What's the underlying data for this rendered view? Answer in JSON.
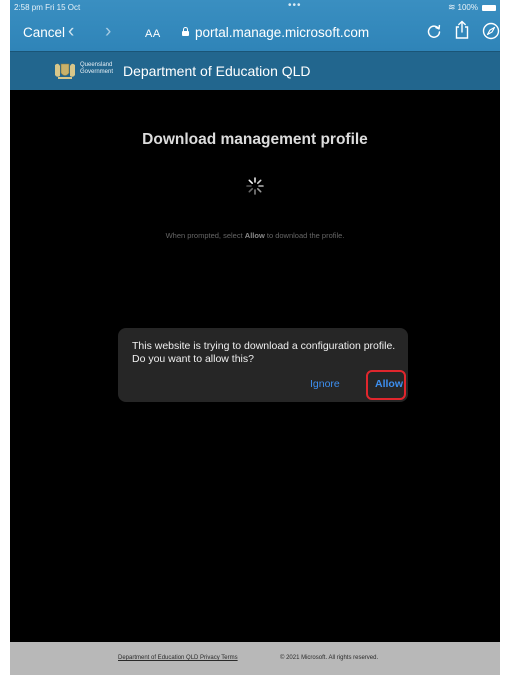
{
  "status_bar": {
    "time": "2:58 pm  Fri 15 Oct",
    "dots": "•••",
    "wifi": "≋",
    "battery": "100%"
  },
  "safari": {
    "cancel_label": "Cancel",
    "back_glyph": "‹",
    "forward_glyph": "›",
    "text_size_label": "AA",
    "url": "portal.manage.microsoft.com"
  },
  "site_header": {
    "gov_line1": "Queensland",
    "gov_line2": "Government",
    "title": "Department of Education QLD"
  },
  "main": {
    "title": "Download management profile",
    "instruction_before": "When prompted, select ",
    "instruction_bold": "Allow",
    "instruction_after": " to download the profile."
  },
  "dialog": {
    "message": "This website is trying to download a configuration profile. Do you want to allow this?",
    "ignore_label": "Ignore",
    "allow_label": "Allow",
    "highlight_color": "#e0262d"
  },
  "footer": {
    "links": "Department of Education QLD Privacy Terms",
    "copyright": "© 2021 Microsoft. All rights reserved."
  },
  "colors": {
    "safari_bar": "#2f84b8",
    "site_header": "#22668e",
    "link_blue": "#3d8ff0",
    "background": "#000000",
    "footer": "#b8b8b8"
  }
}
